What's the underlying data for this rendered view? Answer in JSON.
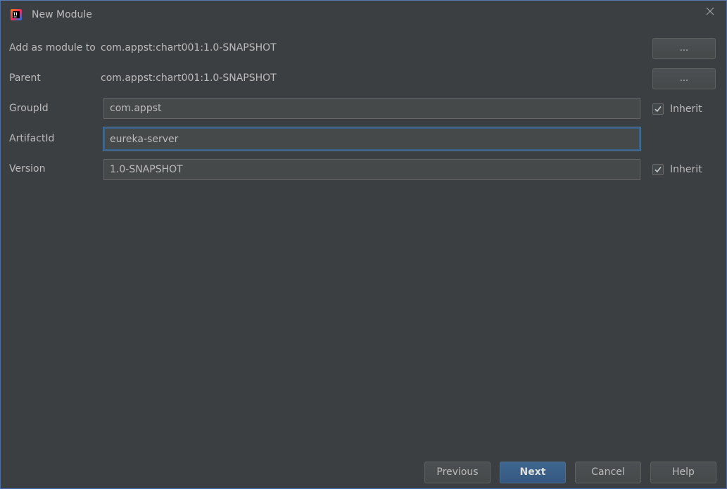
{
  "window": {
    "title": "New Module"
  },
  "form": {
    "add_as_module": {
      "label": "Add as module to",
      "value": "com.appst:chart001:1.0-SNAPSHOT",
      "button_label": "..."
    },
    "parent": {
      "label": "Parent",
      "value": "com.appst:chart001:1.0-SNAPSHOT",
      "button_label": "..."
    },
    "group_id": {
      "label": "GroupId",
      "value": "com.appst",
      "inherit_label": "Inherit",
      "inherit_checked": true
    },
    "artifact_id": {
      "label": "ArtifactId",
      "value": "eureka-server"
    },
    "version": {
      "label": "Version",
      "value": "1.0-SNAPSHOT",
      "inherit_label": "Inherit",
      "inherit_checked": true
    }
  },
  "footer": {
    "previous_label": "Previous",
    "next_label": "Next",
    "cancel_label": "Cancel",
    "help_label": "Help"
  },
  "icons": {
    "app": "intellij-idea-icon",
    "close": "close-icon",
    "check": "checkmark-icon"
  },
  "colors": {
    "background": "#3c3f41",
    "field_background": "#45494a",
    "primary_button": "#365880",
    "focus_border": "#3d6185",
    "text": "#bbbbbb"
  }
}
